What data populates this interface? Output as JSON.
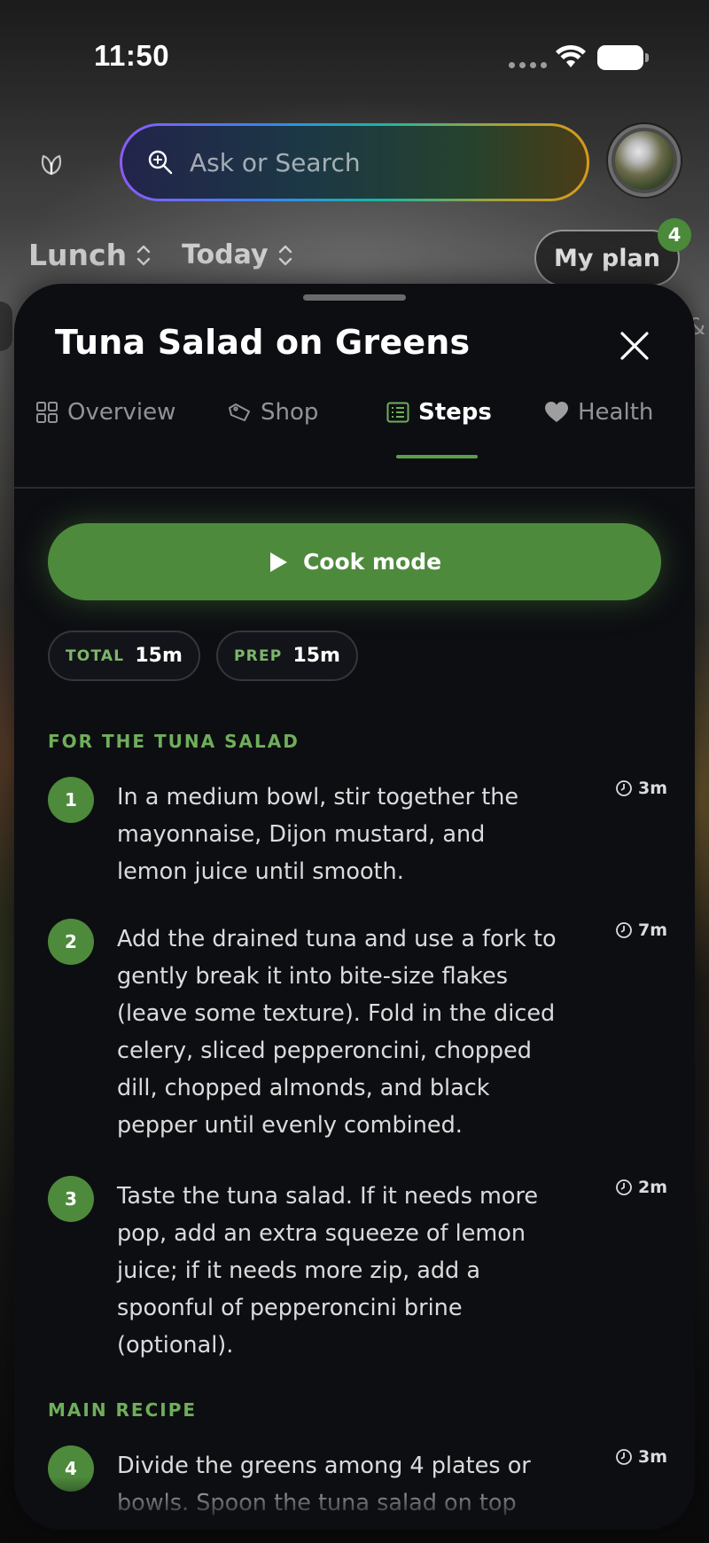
{
  "status_bar": {
    "time": "11:50"
  },
  "search": {
    "placeholder": "Ask or Search"
  },
  "meal_selector": {
    "meal": "Lunch",
    "day": "Today"
  },
  "my_plan": {
    "label": "My plan",
    "badge": "4"
  },
  "peek_right_glyph": "&",
  "recipe": {
    "title": "Tuna Salad on Greens",
    "tabs": [
      {
        "label": "Overview",
        "icon": "grid-icon"
      },
      {
        "label": "Shop",
        "icon": "shopping-tag-icon"
      },
      {
        "label": "Steps",
        "icon": "list-icon",
        "active": true
      },
      {
        "label": "Health",
        "icon": "heart-icon"
      }
    ],
    "cook_mode_label": "Cook mode",
    "times": [
      {
        "label": "TOTAL",
        "value": "15m"
      },
      {
        "label": "PREP",
        "value": "15m"
      }
    ],
    "sections": [
      {
        "heading": "FOR THE TUNA SALAD",
        "steps": [
          {
            "number": "1",
            "text": "In a medium bowl, stir together the mayonnaise, Dijon mustard, and lemon juice until smooth.",
            "time": "3m"
          },
          {
            "number": "2",
            "text": "Add the drained tuna and use a fork to gently break it into bite-size flakes (leave some texture). Fold in the diced celery, sliced pepperoncini, chopped dill, chopped almonds, and black pepper until evenly combined.",
            "time": "7m"
          },
          {
            "number": "3",
            "text": "Taste the tuna salad. If it needs more pop, add an extra squeeze of lemon juice; if it needs more zip, add a spoonful of pepperoncini brine (optional).",
            "time": "2m"
          }
        ]
      },
      {
        "heading": "MAIN RECIPE",
        "steps": [
          {
            "number": "4",
            "text": "Divide the greens among 4 plates or bowls. Spoon the tuna salad on top",
            "time": "3m"
          }
        ]
      }
    ]
  },
  "colors": {
    "accent_green": "#4e8a3c",
    "sheet_bg": "#0d0e12",
    "section_green": "#6fae5a"
  }
}
